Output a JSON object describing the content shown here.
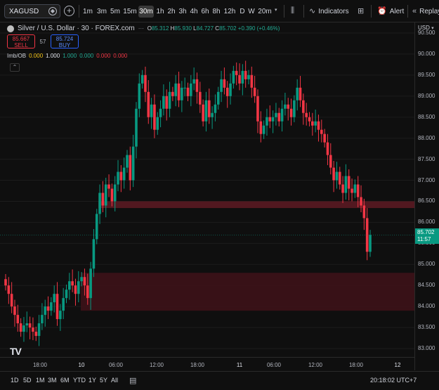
{
  "symbol": "XAGUSD",
  "timeframes": [
    "1m",
    "3m",
    "5m",
    "15m",
    "30m",
    "1h",
    "2h",
    "3h",
    "4h",
    "6h",
    "8h",
    "12h",
    "D",
    "W",
    "20m"
  ],
  "active_timeframe": "30m",
  "toolbar": {
    "indicators_label": "Indicators",
    "alert_label": "Alert",
    "replay_label": "Replay"
  },
  "legend": {
    "title": "Silver / U.S. Dollar · 30 · FOREX.com",
    "ohlc": {
      "o_label": "O",
      "o": "85.312",
      "h_label": "H",
      "h": "85.930",
      "l_label": "L",
      "l": "84.727",
      "c_label": "C",
      "c": "85.702",
      "change": "+0.390 (+0.46%)"
    }
  },
  "trade": {
    "sell_price": "85.667",
    "sell_label": "SELL",
    "spread": "57",
    "buy_price": "85.724",
    "buy_label": "BUY"
  },
  "indicator": {
    "name": "Imb/OB",
    "values": [
      "0.000",
      "1.000",
      "1.000",
      "0.000",
      "0.000",
      "0.000"
    ]
  },
  "collapse_icon": "chevron-up-icon",
  "price_axis": {
    "currency": "USD",
    "labels": [
      "90.500",
      "90.000",
      "89.500",
      "89.000",
      "88.500",
      "88.000",
      "87.500",
      "87.000",
      "86.500",
      "86.000",
      "85.500",
      "85.000",
      "84.500",
      "84.000",
      "83.500",
      "83.000"
    ],
    "current_price": "85.702",
    "countdown": "11:57"
  },
  "time_axis": {
    "labels": [
      "18:00",
      "10",
      "06:00",
      "12:00",
      "18:00",
      "11",
      "06:00",
      "12:00",
      "18:00",
      "12"
    ],
    "clock": "20:18:02 UTC+7"
  },
  "ranges": [
    "1D",
    "5D",
    "1M",
    "3M",
    "6M",
    "YTD",
    "1Y",
    "5Y",
    "All"
  ],
  "logo": "TV",
  "chart_data": {
    "type": "candlestick",
    "ylim": [
      82.8,
      90.75
    ],
    "y_ticks": [
      83.0,
      83.5,
      84.0,
      84.5,
      85.0,
      85.5,
      86.0,
      86.5,
      87.0,
      87.5,
      88.0,
      88.5,
      89.0,
      89.5,
      90.0,
      90.5
    ],
    "zones": [
      {
        "from": 86.34,
        "to": 86.5,
        "color": "#5a1a22"
      },
      {
        "from": 83.9,
        "to": 84.8,
        "color": "#3d1218"
      }
    ],
    "closes": [
      84.5,
      84.3,
      84.0,
      83.8,
      83.6,
      83.4,
      83.55,
      83.6,
      83.5,
      83.4,
      83.3,
      83.6,
      83.8,
      84.0,
      83.9,
      84.1,
      84.3,
      83.7,
      83.9,
      84.2,
      84.4,
      84.6,
      84.5,
      84.3,
      84.6,
      84.7,
      84.5,
      84.2,
      84.9,
      85.6,
      86.2,
      86.7,
      86.4,
      86.9,
      86.8,
      86.5,
      86.9,
      87.2,
      87.0,
      87.3,
      87.6,
      87.0,
      87.8,
      88.7,
      89.3,
      89.5,
      89.1,
      88.5,
      88.8,
      88.2,
      88.5,
      88.7,
      89.0,
      88.7,
      89.1,
      89.0,
      89.3,
      88.9,
      89.2,
      89.2,
      89.0,
      89.3,
      89.4,
      89.1,
      88.8,
      88.4,
      88.9,
      88.5,
      88.6,
      88.8,
      89.1,
      89.4,
      89.2,
      89.0,
      89.3,
      89.6,
      89.5,
      89.3,
      89.6,
      89.4,
      89.5,
      89.2,
      89.0,
      88.4,
      88.1,
      88.3,
      88.5,
      88.4,
      88.5,
      88.6,
      88.4,
      88.7,
      88.8,
      88.7,
      88.5,
      88.9,
      89.2,
      88.9,
      88.6,
      88.5,
      88.4,
      88.3,
      88.4,
      88.2,
      88.1,
      87.9,
      87.6,
      87.3,
      87.0,
      87.2,
      86.9,
      86.7,
      87.1,
      86.8,
      86.7,
      86.9,
      86.6,
      86.4,
      86.1,
      85.3,
      85.7
    ]
  }
}
